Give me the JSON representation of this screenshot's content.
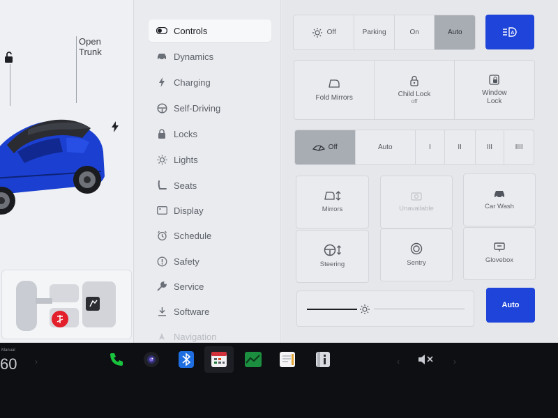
{
  "left": {
    "open_trunk_line1": "Open",
    "open_trunk_line2": "Trunk"
  },
  "nav": {
    "items": [
      {
        "label": "Controls",
        "icon": "toggle-icon"
      },
      {
        "label": "Dynamics",
        "icon": "car-icon"
      },
      {
        "label": "Charging",
        "icon": "bolt-icon"
      },
      {
        "label": "Self-Driving",
        "icon": "steering-wheel-icon"
      },
      {
        "label": "Locks",
        "icon": "lock-icon"
      },
      {
        "label": "Lights",
        "icon": "sun-icon"
      },
      {
        "label": "Seats",
        "icon": "seat-icon"
      },
      {
        "label": "Display",
        "icon": "display-icon"
      },
      {
        "label": "Schedule",
        "icon": "alarm-clock-icon"
      },
      {
        "label": "Safety",
        "icon": "info-circle-icon"
      },
      {
        "label": "Service",
        "icon": "wrench-icon"
      },
      {
        "label": "Software",
        "icon": "download-icon"
      },
      {
        "label": "Navigation",
        "icon": "navigation-arrow-icon"
      }
    ]
  },
  "controls": {
    "headlights": {
      "off": "Off",
      "parking": "Parking",
      "on": "On",
      "auto": "Auto",
      "selected": "Auto"
    },
    "fold_mirrors": "Fold Mirrors",
    "child_lock": "Child Lock",
    "child_lock_state": "off",
    "window_lock_line1": "Window",
    "window_lock_line2": "Lock",
    "wipers": {
      "off": "Off",
      "auto": "Auto",
      "speeds": [
        "I",
        "II",
        "III",
        "IIII"
      ],
      "selected": "Off"
    },
    "mirrors": "Mirrors",
    "unavailable": "Unavailable",
    "car_wash": "Car Wash",
    "steering": "Steering",
    "sentry": "Sentry",
    "glovebox": "Glovebox",
    "brightness_auto": "Auto"
  },
  "taskbar": {
    "temp_mode": "Manual",
    "temp_value": "60"
  },
  "colors": {
    "accent_blue": "#1f44d9",
    "selected_segment": "#a8acb3",
    "car_blue": "#1b3fd0",
    "phone_green": "#19c33d"
  }
}
